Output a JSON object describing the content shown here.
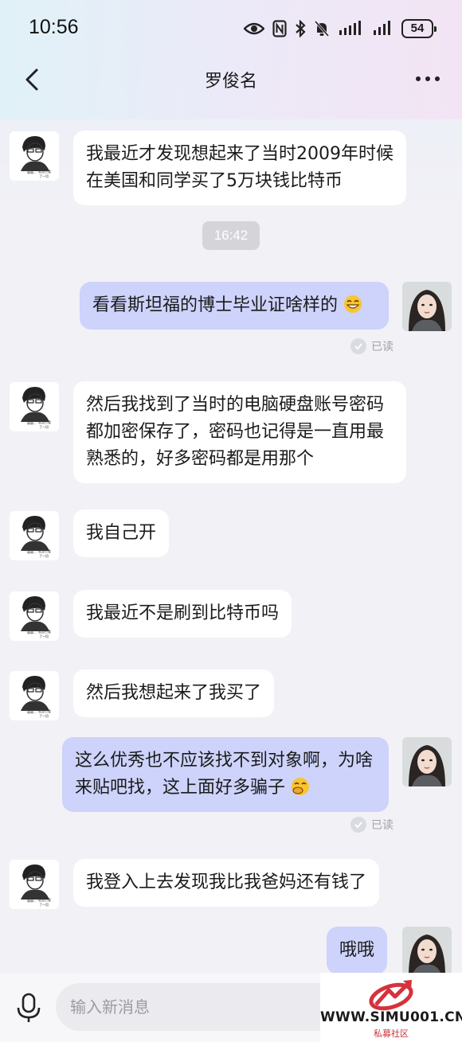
{
  "status_bar": {
    "time": "10:56",
    "battery": "54"
  },
  "header": {
    "title": "罗俊名"
  },
  "messages": [
    {
      "side": "in",
      "text": "我最近才发现想起来了当时2009年时候在美国和同学买了5万块钱比特币"
    },
    {
      "side": "out",
      "text": "看看斯坦福的博士毕业证啥样的",
      "emoji": "grin-emoji",
      "read": "已读"
    },
    {
      "side": "in",
      "text": "然后我找到了当时的电脑硬盘账号密码都加密保存了，密码也记得是一直用最熟悉的，好多密码都是用那个"
    },
    {
      "side": "in",
      "text": "我自己开"
    },
    {
      "side": "in",
      "text": "我最近不是刷到比特币吗"
    },
    {
      "side": "in",
      "text": "然后我想起来了我买了"
    },
    {
      "side": "out",
      "text": "这么优秀也不应该找不到对象啊，为啥来贴吧找，这上面好多骗子",
      "emoji": "giggle-emoji",
      "read": "已读"
    },
    {
      "side": "in",
      "text": "我登入上去发现我比我爸妈还有钱了"
    },
    {
      "side": "out",
      "text": "哦哦"
    }
  ],
  "timestamp": "16:42",
  "input": {
    "placeholder": "输入新消息"
  },
  "watermark": {
    "url": "WWW.SIMU001.CN",
    "sub": "私募社区"
  },
  "colors": {
    "outgoing_bubble": "#cdd3fb",
    "incoming_bubble": "#ffffff",
    "timestamp_bg": "#d5d5d9"
  }
}
